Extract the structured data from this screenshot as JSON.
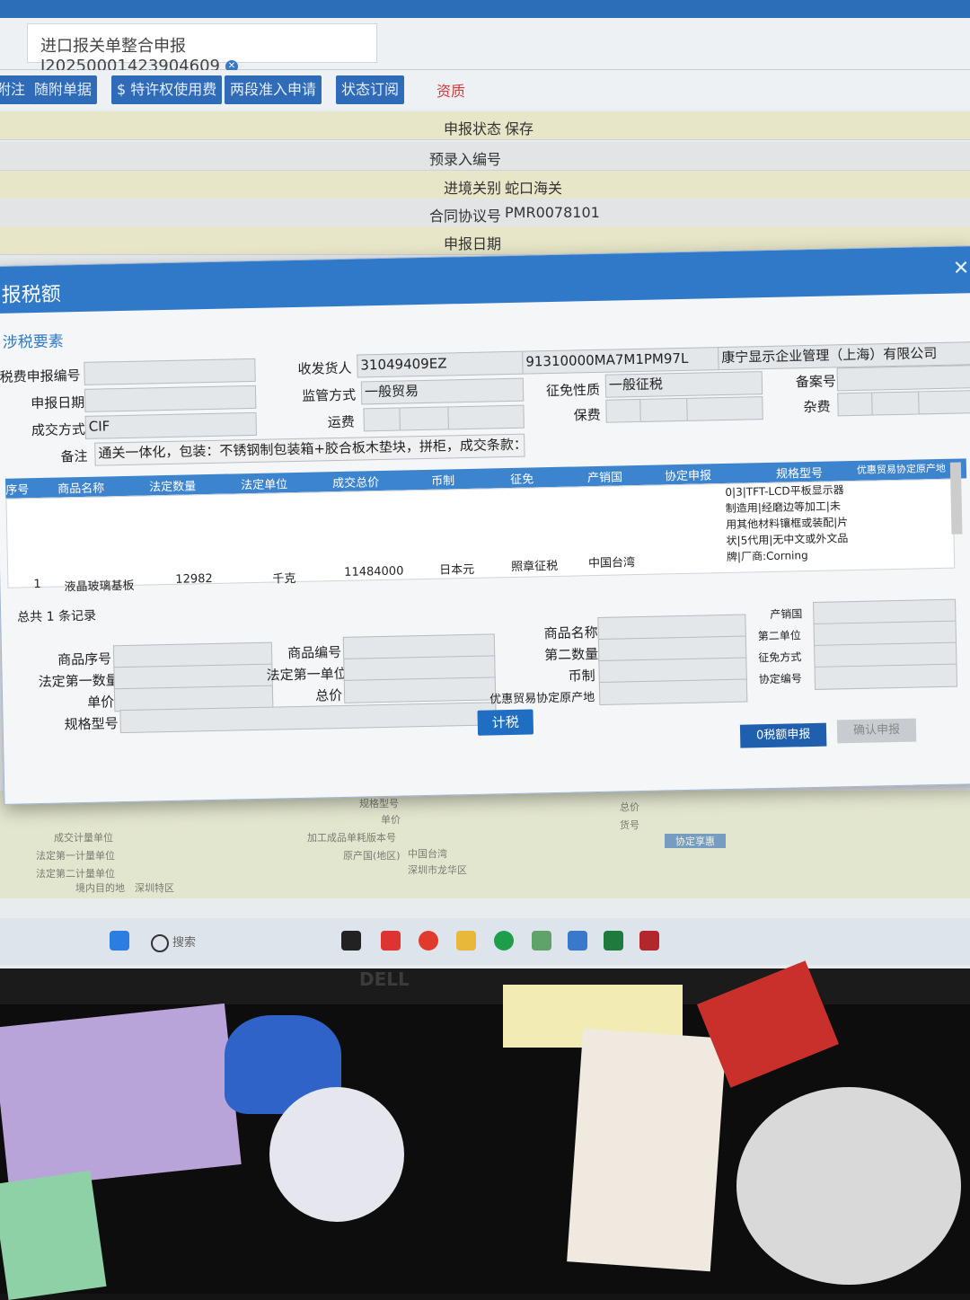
{
  "window": {
    "tab_title": "进口报关单整合申报I20250001423904609",
    "toolbar": [
      {
        "label": "附注"
      },
      {
        "label": "随附单据"
      },
      {
        "label": "$ 特许权使用费"
      },
      {
        "label": "两段准入申请"
      },
      {
        "label": "状态订阅"
      }
    ],
    "toolbar_red": "资质"
  },
  "background_form": [
    {
      "label": "申报状态",
      "value": "保存"
    },
    {
      "label": "预录入编号",
      "value": ""
    },
    {
      "label": "进境关别",
      "value": "蛇口海关"
    },
    {
      "label": "合同协议号",
      "value": "PMR0078101"
    },
    {
      "label": "申报日期",
      "value": ""
    }
  ],
  "modal": {
    "title": "报税额",
    "section": "涉税要素",
    "labels": {
      "tax_no": "税费申报编号",
      "decl_date": "申报日期",
      "deal_mode": "成交方式",
      "remark": "备注",
      "consignee": "收发货人",
      "supervision": "监管方式",
      "freight": "运费",
      "levy": "征免性质",
      "insurance": "保费",
      "record_no": "备案号",
      "misc": "杂费"
    },
    "values": {
      "deal_mode": "CIF",
      "consignee_code": "31049409EZ",
      "credit_code": "91310000MA7M1PM97L",
      "company": "康宁显示企业管理（上海）有限公司",
      "supervision": "一般贸易",
      "levy": "一般征税",
      "remark": "通关一体化，包装：不锈钢制包装箱+胶合板木垫块，拼柜，成交条款：DAP"
    },
    "grid_headers": [
      "序号",
      "商品名称",
      "法定数量",
      "法定单位",
      "成交总价",
      "币制",
      "征免",
      "产销国",
      "协定申报",
      "规格型号",
      "优惠贸易协定原产地"
    ],
    "grid_row": {
      "no": "1",
      "name": "液晶玻璃基板",
      "qty": "12982",
      "unit": "千克",
      "total": "11484000",
      "currency": "日本元",
      "levy": "照章征税",
      "country": "中国台湾",
      "spec": "0|3|TFT-LCD平板显示器制造用|经磨边等加工|未用其他材料镶框或装配|片状|5代用|无中文或外文品牌|厂商:Corning"
    },
    "total_records": "总共 1 条记录",
    "detail_labels": [
      "商品序号",
      "法定第一数量",
      "单价",
      "规格型号",
      "商品编号",
      "法定第一单位",
      "总价",
      "商品名称",
      "第二数量",
      "币制",
      "优惠贸易协定原产地",
      "产销国",
      "第二单位",
      "征免方式",
      "协定编号"
    ],
    "calc_button": "计税",
    "zero_button": "0税额申报",
    "confirm_button": "确认申报"
  },
  "background_lower": [
    "成交计量单位",
    "法定第一计量单位",
    "法定第二计量单位",
    "境内目的地",
    "深圳特区",
    "规格型号",
    "单价",
    "加工成品单耗版本号",
    "原产国(地区)",
    "中国台湾",
    "深圳市龙华区",
    "总价",
    "货号",
    "协定享惠"
  ],
  "taskbar": {
    "search": "搜索"
  },
  "monitor_brand": "DELL",
  "colors": {
    "accent": "#2f79c8",
    "header": "#3d84cf",
    "alert": "#d23b3b"
  }
}
